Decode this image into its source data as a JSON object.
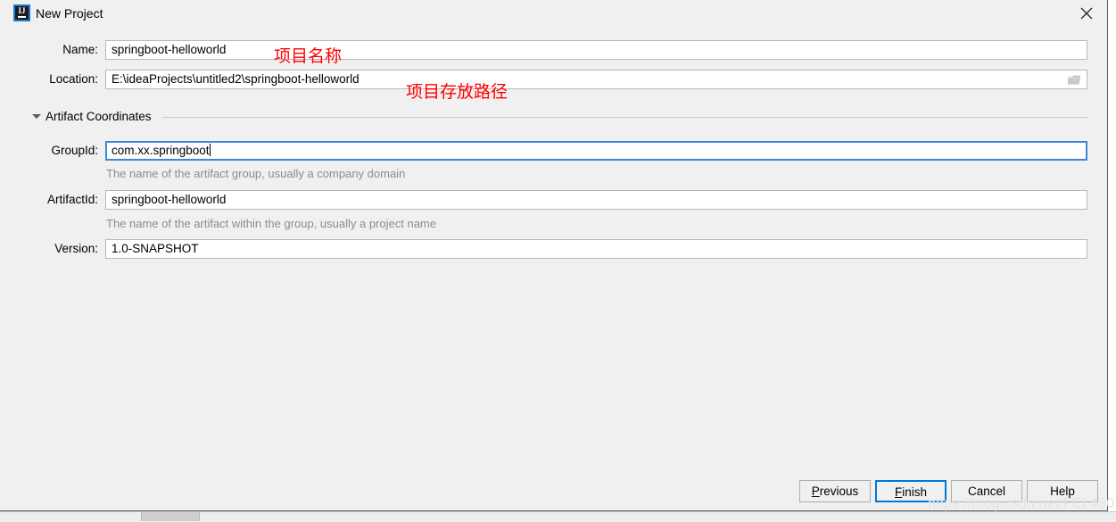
{
  "window": {
    "title": "New Project",
    "app_icon": "intellij-idea-icon",
    "close_icon": "close-icon"
  },
  "form": {
    "name": {
      "label": "Name:",
      "value": "springboot-helloworld"
    },
    "location": {
      "label": "Location:",
      "value": "E:\\ideaProjects\\untitled2\\springboot-helloworld",
      "browse_icon": "folder-icon"
    },
    "group_section": {
      "title": "Artifact Coordinates",
      "expanded": true,
      "collapse_icon": "triangle-down-icon"
    },
    "group_id": {
      "label": "GroupId:",
      "value": "com.xx.springboot",
      "hint": "The name of the artifact group, usually a company domain",
      "focused": true
    },
    "artifact_id": {
      "label": "ArtifactId:",
      "value": "springboot-helloworld",
      "hint": "The name of the artifact within the group, usually a project name"
    },
    "version": {
      "label": "Version:",
      "value": "1.0-SNAPSHOT"
    }
  },
  "annotations": [
    {
      "text": "项目名称",
      "color": "#ff0000"
    },
    {
      "text": "项目存放路径",
      "color": "#ff0000"
    }
  ],
  "footer": {
    "previous": {
      "label_pre": "",
      "accel": "P",
      "label_post": "revious"
    },
    "finish": {
      "label_pre": "",
      "accel": "F",
      "label_post": "inish",
      "is_default": true
    },
    "cancel": {
      "label": "Cancel"
    },
    "help": {
      "label": "Help"
    }
  },
  "watermark": {
    "text": "https://blog.csdn.net/FEL430"
  },
  "colors": {
    "dialog_bg": "#f0f0f0",
    "focus_blue": "#3d87d4",
    "default_button_blue": "#0078d7",
    "annotation_red": "#ff0000",
    "hint_gray": "#8c8c8c"
  }
}
